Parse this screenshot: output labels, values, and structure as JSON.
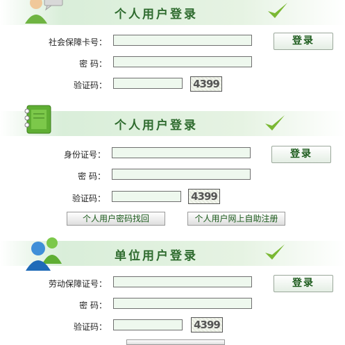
{
  "section1": {
    "title": "个人用户登录",
    "label_card": "社会保障卡号：",
    "label_password": "密    码：",
    "label_captcha": "验证码：",
    "captcha_text": "4399",
    "login_label": "登录"
  },
  "section2": {
    "title": "个人用户登录",
    "label_id": "身份证号：",
    "label_password": "密    码：",
    "label_captcha": "验证码：",
    "captcha_text": "4399",
    "login_label": "登录",
    "recover_label": "个人用户密码找回",
    "register_label": "个人用户网上自助注册"
  },
  "section3": {
    "title": "单位用户登录",
    "label_labor": "劳动保障证号：",
    "label_password": "密    码：",
    "label_captcha": "验证码：",
    "captcha_text": "4399",
    "login_label": "登录"
  },
  "colors": {
    "title_green": "#2e6b2e",
    "field_bg": "#eef8ee",
    "check_green": "#7ab833"
  },
  "icons": [
    "user-chat-icon",
    "notebook-icon",
    "user-group-icon",
    "checkmark-icon"
  ]
}
